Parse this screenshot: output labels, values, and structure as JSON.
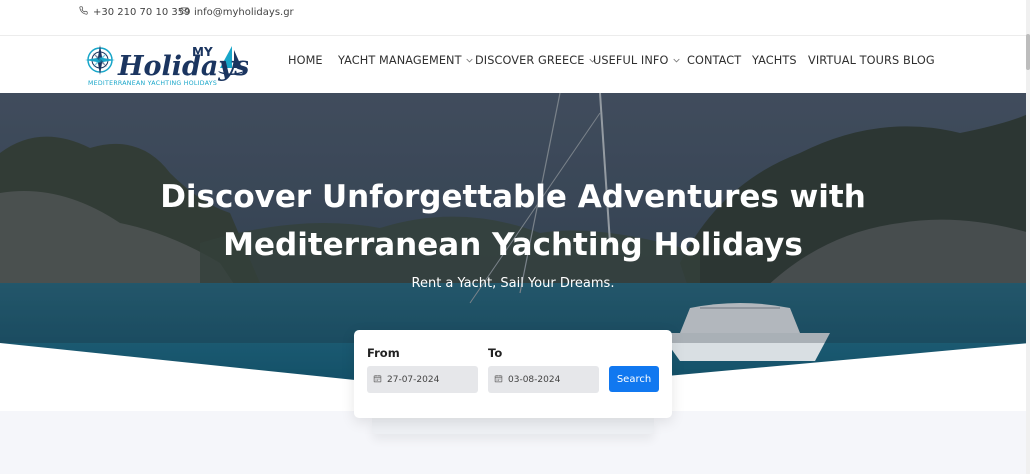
{
  "topbar": {
    "phone": "+30 210 70 10 359",
    "email": "info@myholidays.gr"
  },
  "logo": {
    "my": "MY",
    "name": "Holidays",
    "tagline": "MEDITERRANEAN YACHTING HOLIDAYS",
    "colors": {
      "navy": "#1b3560",
      "teal": "#18a6c9"
    }
  },
  "nav": {
    "items": [
      {
        "label": "HOME",
        "dropdown": false
      },
      {
        "label": "YACHT MANAGEMENT",
        "dropdown": true
      },
      {
        "label": "DISCOVER GREECE",
        "dropdown": true
      },
      {
        "label": "USEFUL INFO",
        "dropdown": true
      },
      {
        "label": "CONTACT",
        "dropdown": false
      },
      {
        "label": "YACHTS",
        "dropdown": false
      },
      {
        "label": "VIRTUAL TOURS",
        "dropdown": false
      },
      {
        "label": "BLOG",
        "dropdown": false
      }
    ]
  },
  "hero": {
    "title_line1": "Discover Unforgettable Adventures with",
    "title_line2": "Mediterranean Yachting Holidays",
    "subtitle": "Rent a Yacht, Sail Your Dreams."
  },
  "booking": {
    "from_label": "From",
    "to_label": "To",
    "from_value": "27-07-2024",
    "to_value": "03-08-2024",
    "search_label": "Search",
    "accent": "#1178f0"
  }
}
